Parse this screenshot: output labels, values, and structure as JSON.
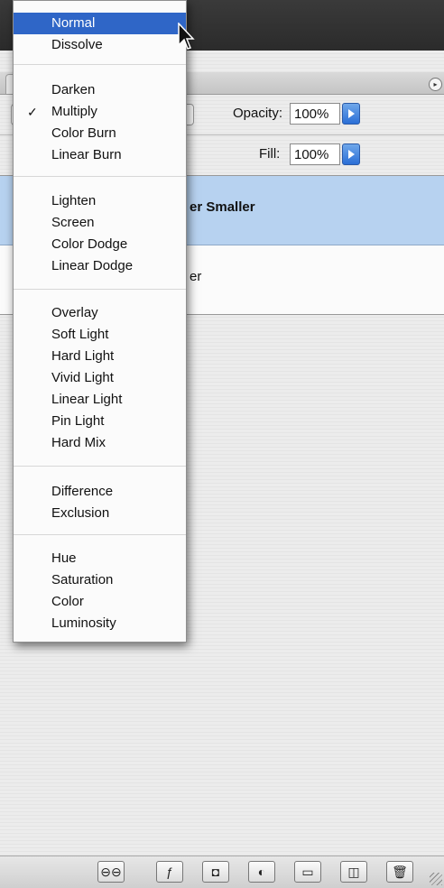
{
  "blend_menu": {
    "items": [
      {
        "label": "Normal",
        "highlighted": true
      },
      {
        "label": "Dissolve"
      },
      {
        "label": "Darken"
      },
      {
        "label": "Multiply",
        "checked": true
      },
      {
        "label": "Color Burn"
      },
      {
        "label": "Linear Burn"
      },
      {
        "label": "Lighten"
      },
      {
        "label": "Screen"
      },
      {
        "label": "Color Dodge"
      },
      {
        "label": "Linear Dodge"
      },
      {
        "label": "Overlay"
      },
      {
        "label": "Soft Light"
      },
      {
        "label": "Hard Light"
      },
      {
        "label": "Vivid Light"
      },
      {
        "label": "Linear Light"
      },
      {
        "label": "Pin Light"
      },
      {
        "label": "Hard Mix"
      },
      {
        "label": "Difference"
      },
      {
        "label": "Exclusion"
      },
      {
        "label": "Hue"
      },
      {
        "label": "Saturation"
      },
      {
        "label": "Color"
      },
      {
        "label": "Luminosity"
      }
    ],
    "check_mark": "✓"
  },
  "layers_panel": {
    "opacity_label": "Opacity:",
    "opacity_value": "100%",
    "fill_label": "Fill:",
    "fill_value": "100%",
    "layers": [
      {
        "name": "er Smaller",
        "selected": true
      },
      {
        "name": "er",
        "selected": false
      }
    ]
  },
  "colors": {
    "menu_highlight": "#2f66c7",
    "selected_layer": "#b7d2f0",
    "stepper_blue": "#2a6ed6"
  },
  "bottom_toolbar": {
    "icons": [
      "link-icon",
      "layer-style-icon",
      "layer-mask-icon",
      "adjustment-layer-icon",
      "folder-icon",
      "new-layer-icon",
      "trash-icon"
    ]
  }
}
